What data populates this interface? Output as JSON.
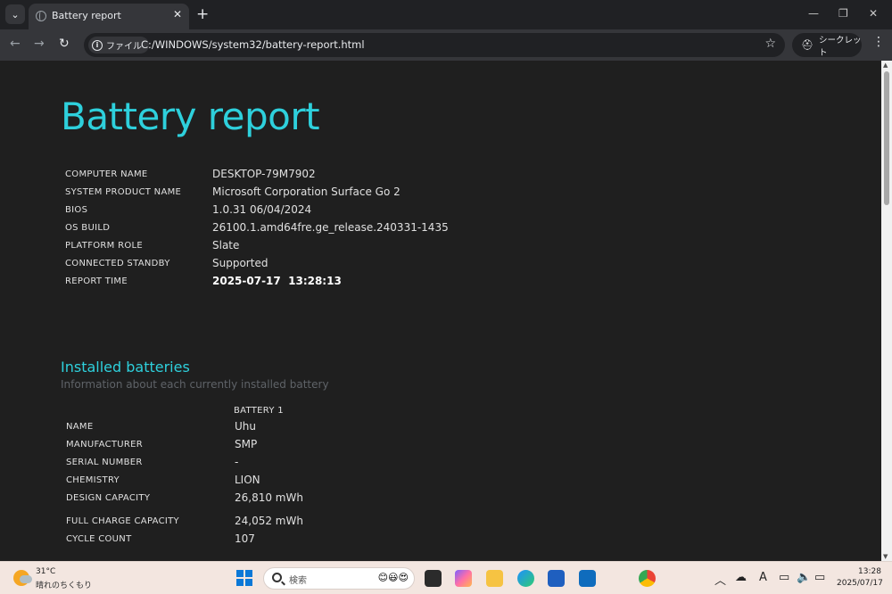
{
  "browser": {
    "tab_title": "Battery report",
    "chip_label": "ファイル",
    "url": "C:/WINDOWS/system32/battery-report.html",
    "incognito_label": "シークレット"
  },
  "report": {
    "title": "Battery report",
    "system_info": [
      {
        "label": "COMPUTER NAME",
        "value": "DESKTOP-79M7902"
      },
      {
        "label": "SYSTEM PRODUCT NAME",
        "value": "Microsoft Corporation Surface Go 2"
      },
      {
        "label": "BIOS",
        "value": "1.0.31 06/04/2024"
      },
      {
        "label": "OS BUILD",
        "value": "26100.1.amd64fre.ge_release.240331-1435"
      },
      {
        "label": "PLATFORM ROLE",
        "value": "Slate"
      },
      {
        "label": "CONNECTED STANDBY",
        "value": "Supported"
      },
      {
        "label": "REPORT TIME",
        "value": "2025-07-17  13:28:13"
      }
    ],
    "installed": {
      "title": "Installed batteries",
      "subtitle": "Information about each currently installed battery",
      "column": "BATTERY 1",
      "rows": [
        {
          "label": "NAME",
          "value": "Uhu"
        },
        {
          "label": "MANUFACTURER",
          "value": "SMP"
        },
        {
          "label": "SERIAL NUMBER",
          "value": "-"
        },
        {
          "label": "CHEMISTRY",
          "value": "LION"
        },
        {
          "label": "DESIGN CAPACITY",
          "value": "26,810 mWh"
        },
        {
          "label": "FULL CHARGE CAPACITY",
          "value": "24,052 mWh"
        },
        {
          "label": "CYCLE COUNT",
          "value": "107"
        }
      ]
    }
  },
  "taskbar": {
    "weather_temp": "31°C",
    "weather_desc": "晴れのちくもり",
    "search_label": "検索",
    "clock_time": "13:28",
    "clock_date": "2025/07/17"
  }
}
